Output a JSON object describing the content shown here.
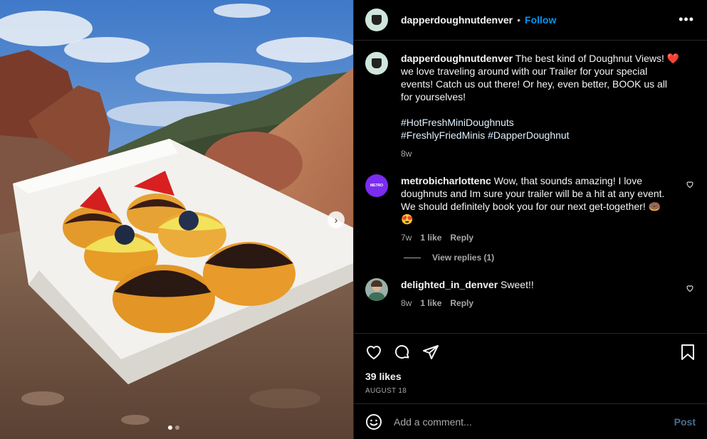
{
  "header": {
    "username": "dapperdoughnutdenver",
    "separator": "•",
    "follow_label": "Follow",
    "more_icon": "more-horizontal-icon"
  },
  "caption": {
    "username": "dapperdoughnutdenver",
    "text": "The best kind of Doughnut Views! ❤️ we love traveling around with our Trailer for your special events! Catch us out there! Or hey, even better, BOOK us all for yourselves!",
    "hashtags": [
      "#HotFreshMiniDoughnuts",
      "#FreshlyFriedMinis",
      "#DapperDoughnut"
    ],
    "age": "8w"
  },
  "comments": [
    {
      "username": "metrobicharlottenc",
      "text": "Wow, that sounds amazing! I love doughnuts and Im sure your trailer will be a hit at any event. We should definitely book you for our next get-together! 🍩😍",
      "age": "7w",
      "likes": "1 like",
      "reply_label": "Reply",
      "view_replies": "View replies (1)"
    },
    {
      "username": "delighted_in_denver",
      "text": "Sweet!!",
      "age": "8w",
      "likes": "1 like",
      "reply_label": "Reply"
    }
  ],
  "actions": {
    "icons": [
      "heart-icon",
      "comment-icon",
      "share-icon",
      "bookmark-icon"
    ]
  },
  "likes_text": "39 likes",
  "date": "AUGUST 18",
  "add_comment": {
    "placeholder": "Add a comment...",
    "post_label": "Post"
  },
  "carousel": {
    "next_icon": "chevron-right-icon",
    "active_index": 1,
    "count": 2
  },
  "colors": {
    "background": "#000000",
    "link_blue": "#0095f6",
    "hashtag": "#e0f1ff",
    "muted": "#a8a8a8",
    "post_disabled": "#4b6f8f"
  }
}
